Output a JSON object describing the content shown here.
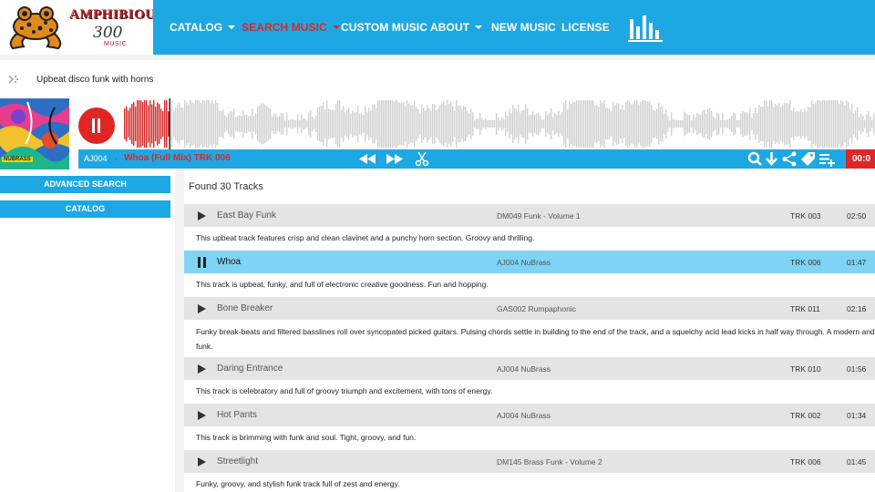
{
  "brand": {
    "name": "AMPHIBIOUS",
    "number": "300",
    "sub": "MUSIC"
  },
  "nav": {
    "items": [
      {
        "label": "CATALOG",
        "dropdown": true,
        "active": false
      },
      {
        "label": "SEARCH MUSIC",
        "dropdown": true,
        "active": true
      },
      {
        "label": "CUSTOM MUSIC",
        "dropdown": false,
        "active": false
      },
      {
        "label": "ABOUT",
        "dropdown": true,
        "active": false
      },
      {
        "label": "NEW MUSIC",
        "dropdown": false,
        "active": false
      },
      {
        "label": "LICENSE",
        "dropdown": false,
        "active": false
      }
    ],
    "eq_icon": "equalizer-icon"
  },
  "search": {
    "query": "Upbeat disco funk with horns",
    "icon": "ai-search-icon"
  },
  "player": {
    "album_tag": "NUBRASS",
    "track_code": "AJ004",
    "separator": "-",
    "track_title": "Whoa (Full Mix) TRK 006",
    "time": "00:0",
    "progress": 0.06,
    "controls": [
      "rewind-icon",
      "fast-forward-icon",
      "scissors-icon",
      "search-similar-icon",
      "download-icon",
      "share-icon",
      "tag-icon",
      "playlist-add-icon"
    ]
  },
  "sidebar": {
    "advanced_search": "ADVANCED SEARCH",
    "catalog": "CATALOG"
  },
  "results": {
    "found_label": "Found 30 Tracks",
    "tracks": [
      {
        "title": "East Bay Funk",
        "album": "DM049 Funk - Volume 1",
        "track": "TRK 003",
        "duration": "02:50",
        "description": "This upbeat track features crisp and clean clavinet and a punchy horn section. Groovy and thrilling.",
        "playing": false
      },
      {
        "title": "Whoa",
        "album": "AJ004 NuBrass",
        "track": "TRK 006",
        "duration": "01:47",
        "description": "This track is upbeat, funky, and full of electronic creative goodness. Fun and hopping.",
        "playing": true
      },
      {
        "title": "Bone Breaker",
        "album": "GAS002 Rumpaphonic",
        "track": "TRK 011",
        "duration": "02:16",
        "description": "Funky break-beats and filtered basslines roll over syncopated picked guitars. Pulsing chords settle in building to the end of the track, and a squelchy acid lead kicks in half way through. A modern and funk.",
        "playing": false
      },
      {
        "title": "Daring Entrance",
        "album": "AJ004 NuBrass",
        "track": "TRK 010",
        "duration": "01:56",
        "description": "This track is celebratory and full of groovy triumph and excitement, with tons of energy.",
        "playing": false
      },
      {
        "title": "Hot Pants",
        "album": "AJ004 NuBrass",
        "track": "TRK 002",
        "duration": "01:34",
        "description": "This track is brimming with funk and soul. Tight, groovy, and fun.",
        "playing": false
      },
      {
        "title": "Streetlight",
        "album": "DM145 Brass Funk - Volume 2",
        "track": "TRK 006",
        "duration": "01:45",
        "description": "Funky, groovy, and stylish funk track full of zest and energy.",
        "playing": false
      }
    ]
  },
  "colors": {
    "accent": "#1ea8e3",
    "active_red": "#d42a2a",
    "playing_row": "#7fd3f4",
    "row_bg": "#e4e4e4"
  }
}
